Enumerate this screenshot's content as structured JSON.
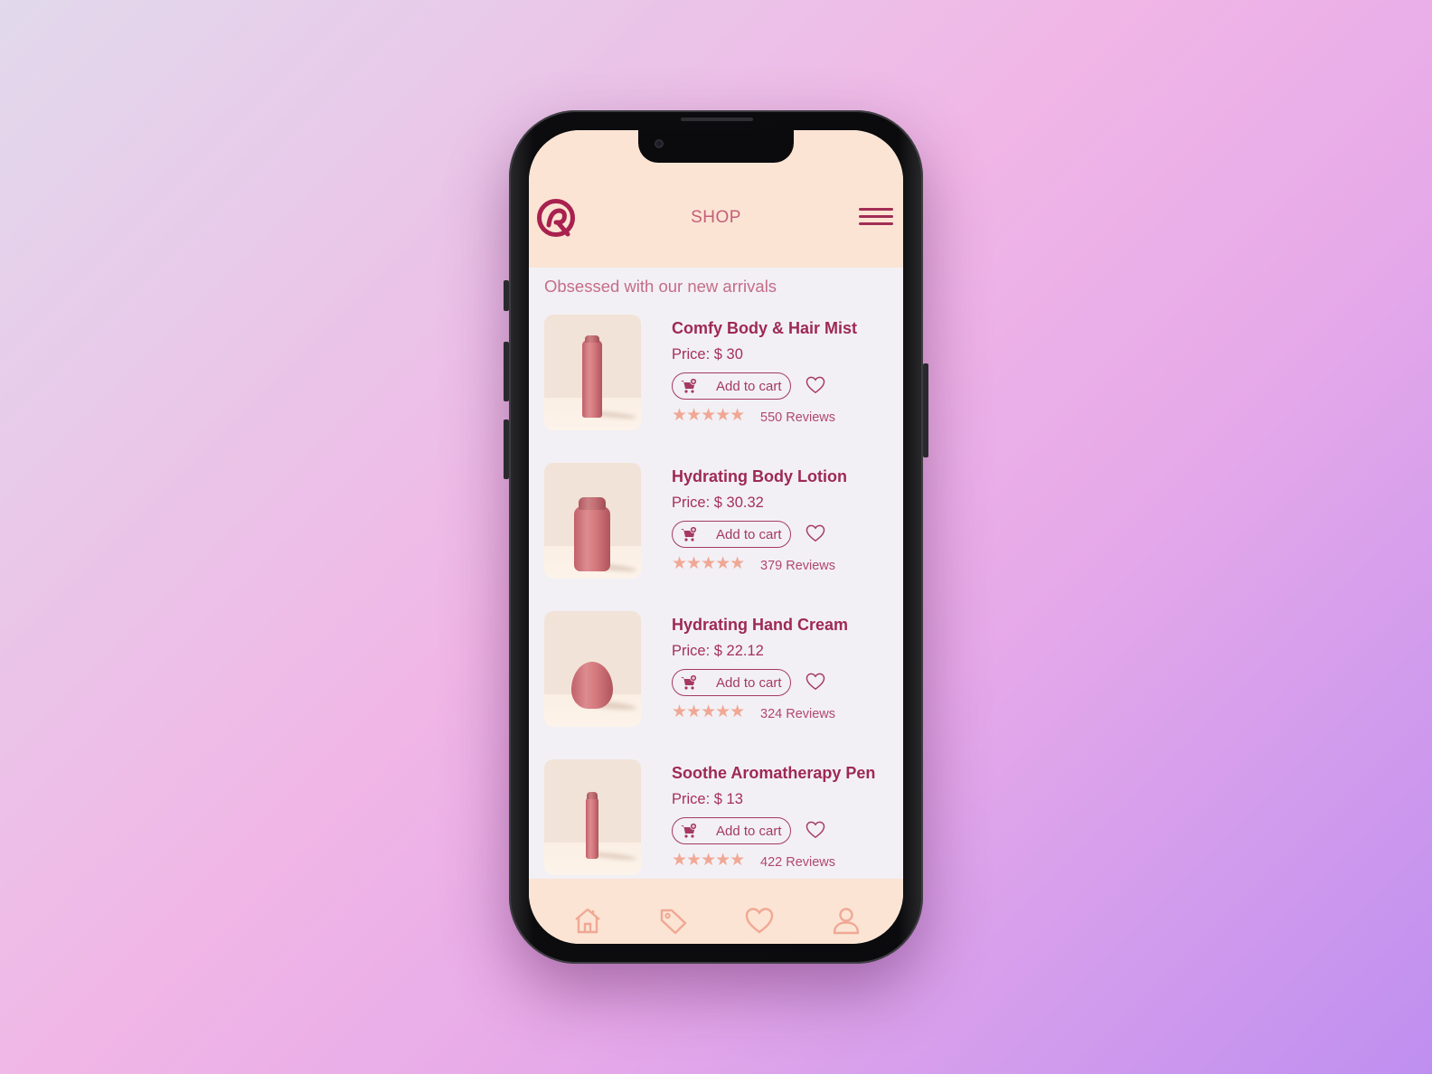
{
  "header": {
    "title": "SHOP"
  },
  "section": {
    "subtitle": "Obsessed with our new arrivals"
  },
  "products": [
    {
      "name": "Comfy Body & Hair Mist",
      "price": "Price: $ 30",
      "cart_label": "Add to cart",
      "reviews": "550 Reviews",
      "rating": 5
    },
    {
      "name": "Hydrating Body Lotion",
      "price": "Price: $ 30.32",
      "cart_label": "Add to cart",
      "reviews": "379 Reviews",
      "rating": 5
    },
    {
      "name": "Hydrating Hand Cream",
      "price": "Price: $ 22.12",
      "cart_label": "Add to cart",
      "reviews": "324 Reviews",
      "rating": 5
    },
    {
      "name": "Soothe Aromatherapy Pen",
      "price": "Price: $ 13",
      "cart_label": "Add to cart",
      "reviews": "422 Reviews",
      "rating": 5
    }
  ],
  "tabbar": {
    "icons": [
      "home-icon",
      "tag-icon",
      "heart-icon",
      "user-icon"
    ]
  },
  "colors": {
    "accent": "#9e2953",
    "header_bg": "#fbe4d3",
    "star": "#f0a895"
  }
}
